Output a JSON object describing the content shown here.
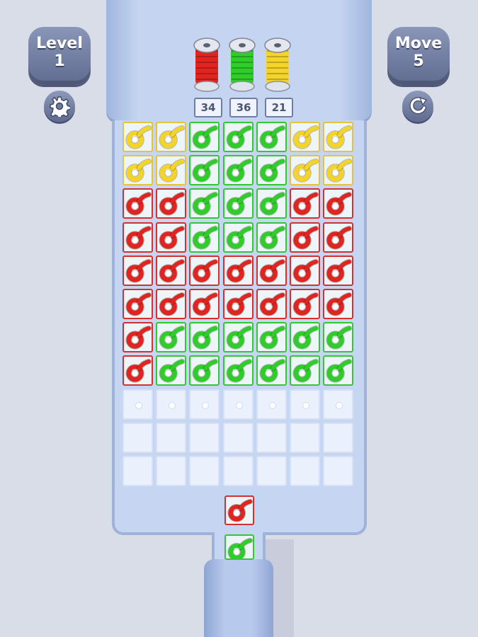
{
  "hud": {
    "level_label": "Level",
    "level_value": "1",
    "move_label": "Move",
    "move_value": "5",
    "settings_icon": "gear-icon",
    "restart_icon": "restart-icon"
  },
  "colors": {
    "yellow": "#f4d32a",
    "green": "#2fcc2a",
    "red": "#e0241f",
    "yellow_border": "#e3c43c",
    "green_border": "#35c635",
    "red_border": "#d33030"
  },
  "spools": [
    {
      "color": "red",
      "count": "34"
    },
    {
      "color": "green",
      "count": "36"
    },
    {
      "color": "yellow",
      "count": "21"
    }
  ],
  "grid": {
    "columns": 7,
    "rows": [
      [
        "Y",
        "Y",
        "G",
        "G",
        "G",
        "Y",
        "Y"
      ],
      [
        "Y",
        "Y",
        "G",
        "G",
        "G",
        "Y",
        "Y"
      ],
      [
        "R",
        "R",
        "G",
        "G",
        "G",
        "R",
        "R"
      ],
      [
        "R",
        "R",
        "G",
        "G",
        "G",
        "R",
        "R"
      ],
      [
        "R",
        "R",
        "R",
        "R",
        "R",
        "R",
        "R"
      ],
      [
        "R",
        "R",
        "R",
        "R",
        "R",
        "R",
        "R"
      ],
      [
        "R",
        "G",
        "G",
        "G",
        "G",
        "G",
        "G"
      ],
      [
        "R",
        "G",
        "G",
        "G",
        "G",
        "G",
        "G"
      ],
      [
        "E",
        "E",
        "E",
        "E",
        "E",
        "E",
        "E"
      ],
      [
        "0",
        "0",
        "0",
        "0",
        "0",
        "0",
        "0"
      ],
      [
        "0",
        "0",
        "0",
        "0",
        "0",
        "0",
        "0"
      ]
    ]
  },
  "queue": [
    "R",
    "G"
  ]
}
